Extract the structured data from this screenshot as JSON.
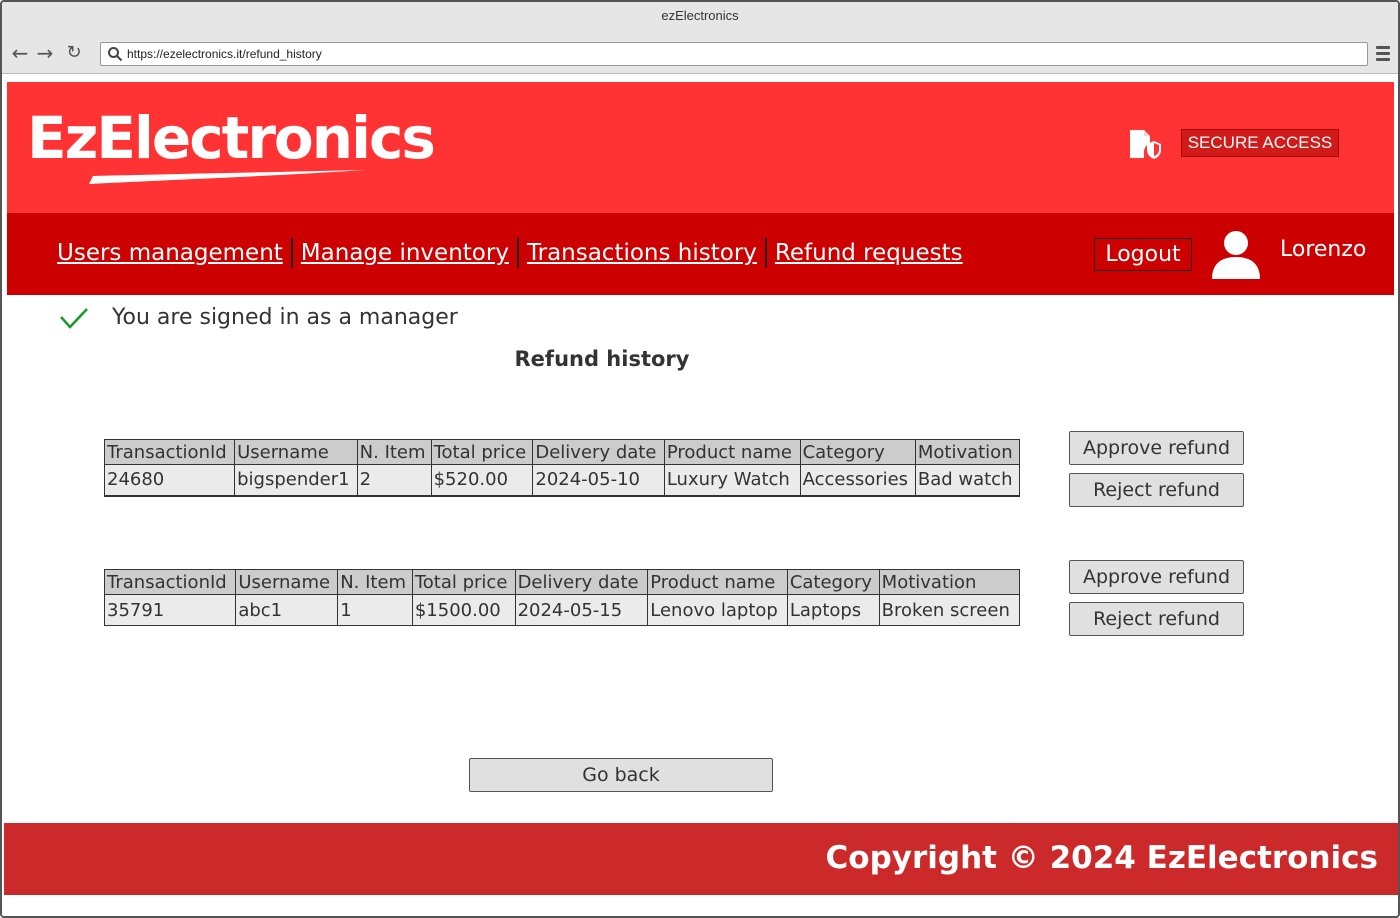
{
  "browser": {
    "window_title": "ezElectronics",
    "url": "https://ezelectronics.it/refund_history"
  },
  "header": {
    "logo_text": "EzElectronics",
    "secure_access_label": "SECURE ACCESS"
  },
  "navbar": {
    "links": [
      {
        "label": "Users management"
      },
      {
        "label": "Manage inventory"
      },
      {
        "label": "Transactions history"
      },
      {
        "label": "Refund requests"
      }
    ],
    "logout_label": "Logout",
    "username": "Lorenzo"
  },
  "status": {
    "signed_in_text": "You are signed in as a manager"
  },
  "main": {
    "title": "Refund history",
    "columns": [
      "TransactionId",
      "Username",
      "N. Item",
      "Total price",
      "Delivery date",
      "Product name",
      "Category",
      "Motivation"
    ],
    "refunds": [
      {
        "row": [
          "24680",
          "bigspender1",
          "2",
          "$520.00",
          "2024-05-10",
          "Luxury Watch",
          "Accessories",
          "Bad watch"
        ],
        "approve_label": "Approve refund",
        "reject_label": "Reject refund"
      },
      {
        "row": [
          "35791",
          "abc1",
          "1",
          "$1500.00",
          "2024-05-15",
          "Lenovo laptop",
          "Laptops",
          "Broken screen"
        ],
        "approve_label": "Approve refund",
        "reject_label": "Reject refund"
      }
    ],
    "go_back_label": "Go back"
  },
  "footer": {
    "copyright": "Copyright © 2024 EzElectronics"
  },
  "colors": {
    "header_red": "#ff3333",
    "nav_red": "#cc0000",
    "footer_red": "#cc2a2a",
    "check_green": "#1a9a2a"
  }
}
